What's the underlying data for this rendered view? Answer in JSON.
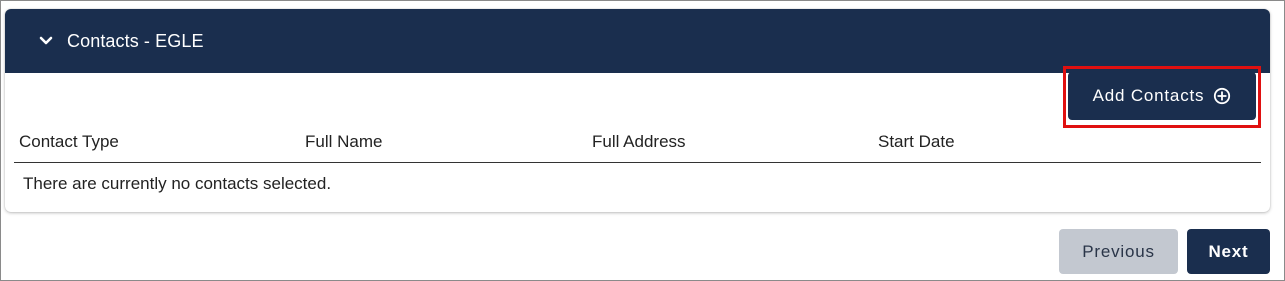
{
  "section": {
    "title": "Contacts - EGLE",
    "expanded": true
  },
  "toolbar": {
    "add_label": "Add Contacts"
  },
  "table": {
    "columns": [
      "Contact Type",
      "Full Name",
      "Full Address",
      "Start Date"
    ],
    "empty_message": "There are currently no contacts selected."
  },
  "navigation": {
    "previous_label": "Previous",
    "next_label": "Next"
  },
  "colors": {
    "primary": "#1a2e4e",
    "secondary_button": "#c3c8d0",
    "highlight": "#e01010"
  },
  "icons": {
    "header_toggle": "chevron-down-icon",
    "add_button": "plus-circle-icon"
  }
}
